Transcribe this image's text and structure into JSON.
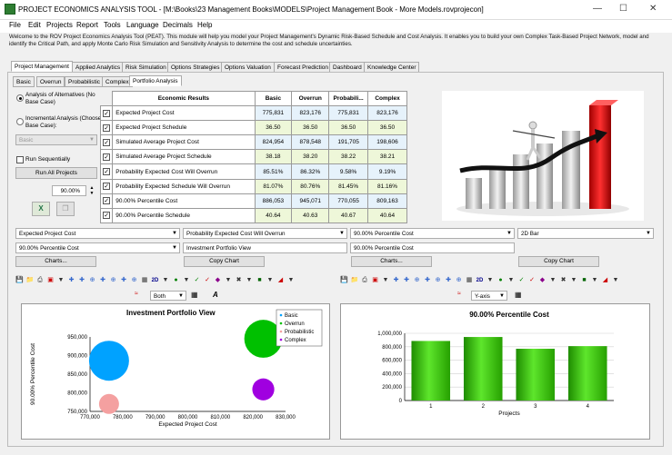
{
  "app": {
    "title": "PROJECT ECONOMICS ANALYSIS TOOL - [M:\\Books\\23 Management Books\\MODELS\\Project Management Book - More Models.rovprojecon]",
    "description": "Welcome to the ROV Project Economics Analysis Tool (PEAT). This module will help you model your Project Management's Dynamic Risk-Based Schedule and Cost Analysis. It enables you to build your own Complex Task-Based Project Network, model and identify the Critical Path, and apply Monte Carlo Risk Simulation and Sensitivity Analysis to determine the cost and schedule uncertainties."
  },
  "menu": [
    "File",
    "Edit",
    "Projects",
    "Report",
    "Tools",
    "Language",
    "Decimals",
    "Help"
  ],
  "main_tabs": [
    "Project Management",
    "Applied Analytics",
    "Risk Simulation",
    "Options Strategies",
    "Options Valuation",
    "Forecast Prediction",
    "Dashboard",
    "Knowledge Center"
  ],
  "sub_tabs": [
    "Basic",
    "Overrun",
    "Probabilistic",
    "Complex",
    "Portfolio Analysis"
  ],
  "left": {
    "radio1": "Analysis of Alternatives (No Base Case)",
    "radio2": "Incremental Analysis (Choose Base Case):",
    "base_select": "Basic",
    "run_seq": "Run Sequentially",
    "run_all": "Run All Projects",
    "pct": "90.00%"
  },
  "results": {
    "headers": [
      "Economic Results",
      "Basic",
      "Overrun",
      "Probabili...",
      "Complex"
    ],
    "rows": [
      [
        "Expected Project Cost",
        "775,831",
        "823,176",
        "775,831",
        "823,176"
      ],
      [
        "Expected Project Schedule",
        "36.50",
        "36.50",
        "36.50",
        "36.50"
      ],
      [
        "Simulated Average Project Cost",
        "824,954",
        "878,548",
        "191,705",
        "198,606"
      ],
      [
        "Simulated Average Project Schedule",
        "38.18",
        "38.20",
        "38.22",
        "38.21"
      ],
      [
        "Probability Expected Cost Will Overrun",
        "85.51%",
        "86.32%",
        "9.58%",
        "9.19%"
      ],
      [
        "Probability Expected Schedule Will Overrun",
        "81.07%",
        "80.76%",
        "81.45%",
        "81.16%"
      ],
      [
        "90.00% Percentile Cost",
        "886,053",
        "945,071",
        "770,055",
        "809,163"
      ],
      [
        "90.00% Percentile Schedule",
        "40.64",
        "40.63",
        "40.67",
        "40.64"
      ]
    ]
  },
  "controls": {
    "combo1": "Expected Project Cost",
    "combo2": "Probability Expected Cost Will Overrun",
    "combo3": "90.00% Percentile Cost",
    "combo4": "2D Bar",
    "combo5": "90.00% Percentile Cost",
    "field1": "Investment Portfolio View",
    "field2": "90.00% Percentile Cost",
    "charts_btn": "Charts...",
    "copy_btn": "Copy Chart",
    "charts_btn2": "Charts...",
    "copy_btn2": "Copy Chart"
  },
  "left_chart_toolbar": {
    "grid_select": "Both"
  },
  "right_chart_toolbar": {
    "axis_select": "Y-axis"
  },
  "chart_data": [
    {
      "type": "scatter",
      "title": "Investment Portfolio View",
      "xlabel": "Expected Project Cost",
      "ylabel": "90.00% Percentile Cost",
      "xlim": [
        770000,
        830000
      ],
      "ylim": [
        750000,
        950000
      ],
      "xticks": [
        "770,000",
        "780,000",
        "790,000",
        "800,000",
        "810,000",
        "820,000",
        "830,000"
      ],
      "yticks": [
        "750,000",
        "800,000",
        "850,000",
        "900,000",
        "950,000"
      ],
      "legend": [
        "Basic",
        "Overrun",
        "Probabilistic",
        "Complex"
      ],
      "legend_position": "top-right",
      "series": [
        {
          "name": "Basic",
          "x": 775831,
          "y": 886053,
          "color": "#00a2ff",
          "size": 1.0
        },
        {
          "name": "Overrun",
          "x": 823176,
          "y": 945071,
          "color": "#00c000",
          "size": 0.95
        },
        {
          "name": "Probabilistic",
          "x": 775831,
          "y": 770055,
          "color": "#f4a0a0",
          "size": 0.5
        },
        {
          "name": "Complex",
          "x": 823176,
          "y": 809163,
          "color": "#a000e0",
          "size": 0.55
        }
      ]
    },
    {
      "type": "bar",
      "title": "90.00% Percentile Cost",
      "xlabel": "Projects",
      "ylabel": "",
      "categories": [
        "1",
        "2",
        "3",
        "4"
      ],
      "values": [
        886053,
        945071,
        770055,
        809163
      ],
      "ylim": [
        0,
        1000000
      ],
      "yticks": [
        "0",
        "200,000",
        "400,000",
        "600,000",
        "800,000",
        "1,000,000"
      ],
      "color": "#33cc00",
      "grid": true
    }
  ]
}
